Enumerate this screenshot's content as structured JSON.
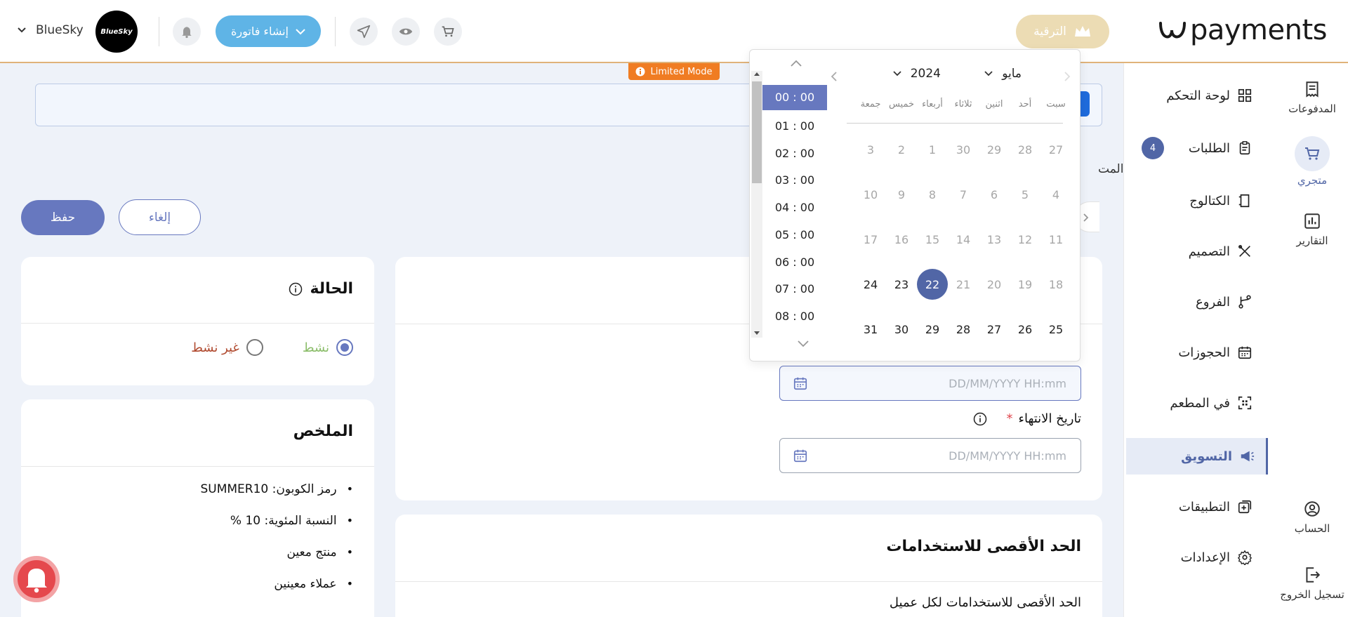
{
  "header": {
    "logo_text": "payments",
    "upgrade_label": "الترقية",
    "create_invoice_label": "إنشاء فاتورة",
    "store_name": "BlueSky",
    "avatar_text": "BlueSky"
  },
  "icon_sidebar": {
    "items": [
      {
        "label": "المدفوعات",
        "icon": "payments-icon"
      },
      {
        "label": "متجري",
        "icon": "cart-icon",
        "active": true
      },
      {
        "label": "التقارير",
        "icon": "chart-icon"
      },
      {
        "label": "الحساب",
        "icon": "account-icon"
      },
      {
        "label": "تسجيل الخروج",
        "icon": "logout-icon"
      }
    ]
  },
  "nav": {
    "items": [
      {
        "label": "لوحة التحكم",
        "icon": "dashboard-icon"
      },
      {
        "label": "الطلبات",
        "icon": "orders-icon",
        "badge": "4"
      },
      {
        "label": "الكتالوج",
        "icon": "catalog-icon"
      },
      {
        "label": "التصميم",
        "icon": "design-icon"
      },
      {
        "label": "الفروع",
        "icon": "branches-icon"
      },
      {
        "label": "الحجوزات",
        "icon": "calendar-icon"
      },
      {
        "label": "في المطعم",
        "icon": "qr-icon"
      },
      {
        "label": "التسويق",
        "icon": "megaphone-icon",
        "active": true
      },
      {
        "label": "التطبيقات",
        "icon": "apps-icon"
      },
      {
        "label": "الإعدادات",
        "icon": "settings-icon"
      }
    ]
  },
  "banner": {
    "limited_mode": "Limited Mode"
  },
  "side_text": "المت",
  "actions": {
    "save": "حفظ",
    "cancel": "إلغاء"
  },
  "status_card": {
    "title": "الحالة",
    "options": [
      {
        "label": "نشط",
        "checked": true,
        "color": "#8bbd6a"
      },
      {
        "label": "غير نشط",
        "checked": false,
        "color": "#b04a2f"
      }
    ]
  },
  "summary_card": {
    "title": "الملخص",
    "items": [
      "رمز الكوبون: SUMMER10",
      "النسبة المئوية: 10 %",
      "منتج معين",
      "عملاء معينين"
    ]
  },
  "dates": {
    "start_placeholder": "DD/MM/YYYY HH:mm",
    "end_label": "تاريخ الانتهاء",
    "end_required": "*",
    "end_placeholder": "DD/MM/YYYY HH:mm"
  },
  "max_usage_card": {
    "title": "الحد الأقصى للاستخدامات",
    "partial_label": "الحد الأقصى للاستخدامات لكل عميل"
  },
  "datepicker": {
    "month": "مايو",
    "year": "2024",
    "weekdays": [
      "سبت",
      "أحد",
      "اثنين",
      "ثلاثاء",
      "أربعاء",
      "خميس",
      "جمعة"
    ],
    "weeks": [
      [
        "27",
        "28",
        "29",
        "30",
        "1",
        "2",
        "3"
      ],
      [
        "4",
        "5",
        "6",
        "7",
        "8",
        "9",
        "10"
      ],
      [
        "11",
        "12",
        "13",
        "14",
        "15",
        "16",
        "17"
      ],
      [
        "18",
        "19",
        "20",
        "21",
        "22",
        "23",
        "24"
      ],
      [
        "25",
        "26",
        "27",
        "28",
        "29",
        "30",
        "31"
      ]
    ],
    "selected_day": "22",
    "times": [
      "00 : 00",
      "01 : 00",
      "02 : 00",
      "03 : 00",
      "04 : 00",
      "05 : 00",
      "06 : 00",
      "07 : 00",
      "08 : 00"
    ],
    "selected_time": "00 : 00"
  },
  "colors": {
    "primary": "#5166a6",
    "button": "#6778bf",
    "accent_orange": "#f07c22",
    "invoice_blue": "#5fb4e6",
    "upgrade_gold": "#ecdcb4"
  }
}
